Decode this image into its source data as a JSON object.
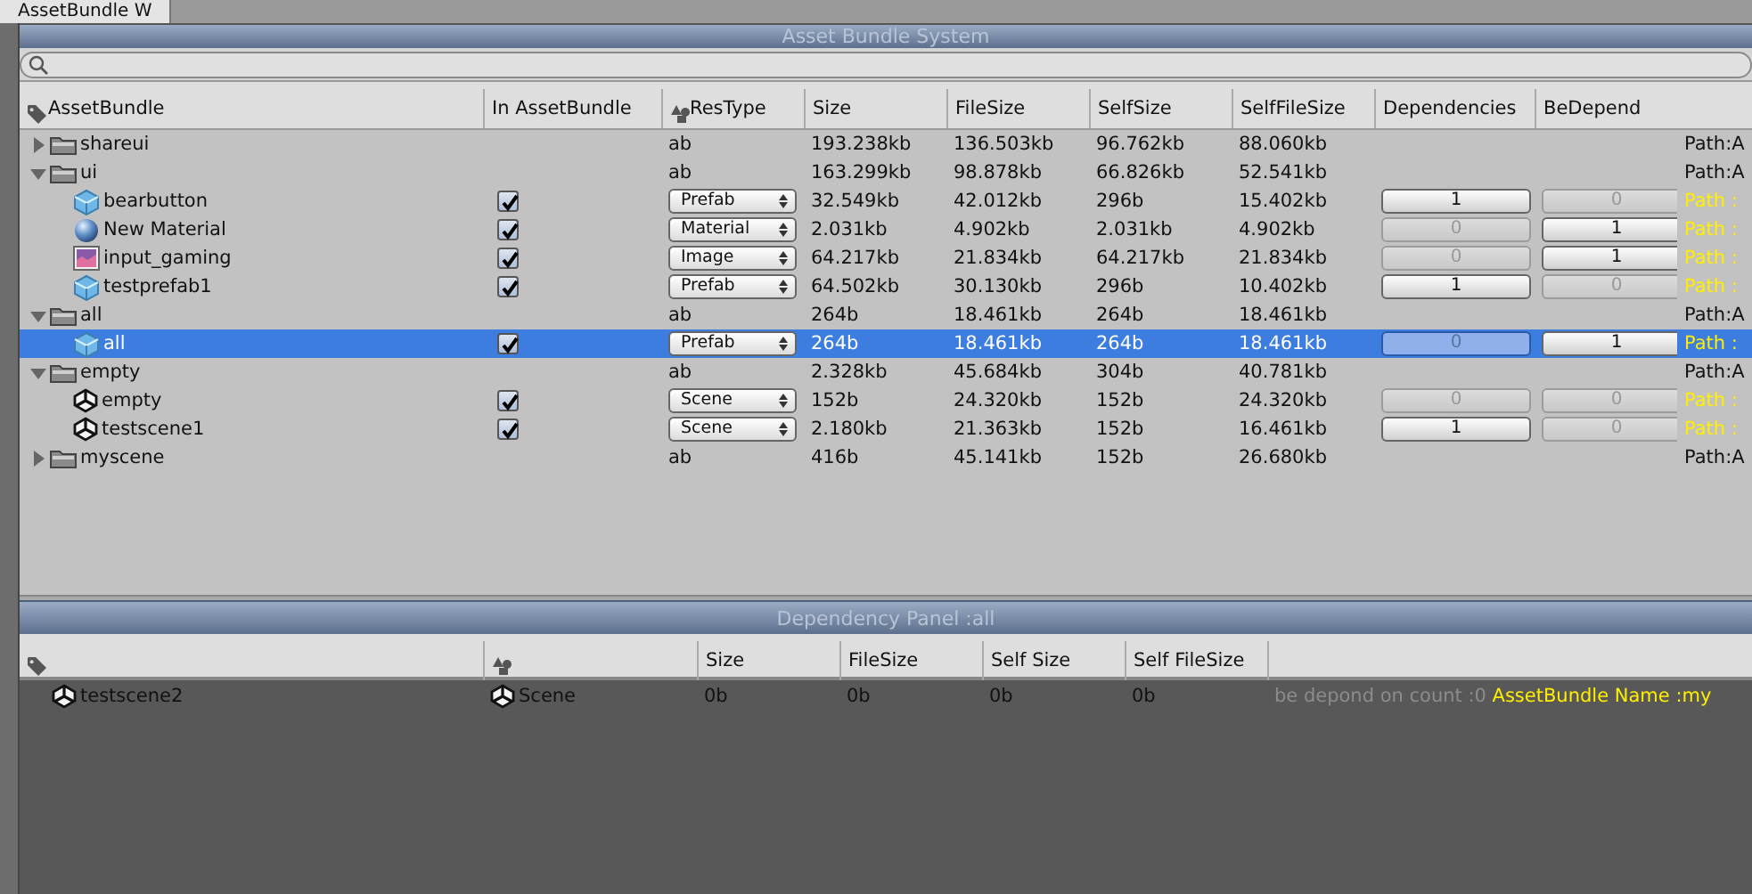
{
  "tab": {
    "title": "AssetBundle W"
  },
  "title": "Asset Bundle System",
  "columns": [
    "AssetBundle",
    "In AssetBundle",
    "ResType",
    "Size",
    "FileSize",
    "SelfSize",
    "SelfFileSize",
    "Dependencies",
    "BeDepend"
  ],
  "bundles": [
    {
      "name": "shareui",
      "expanded": false,
      "selected": false,
      "res_type": "ab",
      "size": "193.238kb",
      "file_size": "136.503kb",
      "self_size": "96.762kb",
      "self_file_size": "88.060kb",
      "path": "Path:A"
    },
    {
      "name": "ui",
      "expanded": true,
      "selected": false,
      "res_type": "ab",
      "size": "163.299kb",
      "file_size": "98.878kb",
      "self_size": "66.826kb",
      "self_file_size": "52.541kb",
      "path": "Path:A",
      "children": [
        {
          "name": "bearbutton",
          "kind": "prefab",
          "in_bundle": true,
          "selected": false,
          "res_type": "Prefab",
          "size": "32.549kb",
          "file_size": "42.012kb",
          "self_size": "296b",
          "self_file_size": "15.402kb",
          "dependencies": {
            "label": "1",
            "disabled": false
          },
          "be_depend": {
            "label": "0",
            "disabled": true
          },
          "path": "Path :"
        },
        {
          "name": "New Material",
          "kind": "material",
          "in_bundle": true,
          "selected": false,
          "res_type": "Material",
          "size": "2.031kb",
          "file_size": "4.902kb",
          "self_size": "2.031kb",
          "self_file_size": "4.902kb",
          "dependencies": {
            "label": "0",
            "disabled": true
          },
          "be_depend": {
            "label": "1",
            "disabled": false
          },
          "path": "Path :"
        },
        {
          "name": "input_gaming",
          "kind": "image",
          "in_bundle": true,
          "selected": false,
          "res_type": "Image",
          "size": "64.217kb",
          "file_size": "21.834kb",
          "self_size": "64.217kb",
          "self_file_size": "21.834kb",
          "dependencies": {
            "label": "0",
            "disabled": true
          },
          "be_depend": {
            "label": "1",
            "disabled": false
          },
          "path": "Path :"
        },
        {
          "name": "testprefab1",
          "kind": "prefab",
          "in_bundle": true,
          "selected": false,
          "res_type": "Prefab",
          "size": "64.502kb",
          "file_size": "30.130kb",
          "self_size": "296b",
          "self_file_size": "10.402kb",
          "dependencies": {
            "label": "1",
            "disabled": false
          },
          "be_depend": {
            "label": "0",
            "disabled": true
          },
          "path": "Path :"
        }
      ]
    },
    {
      "name": "all",
      "expanded": true,
      "selected": false,
      "res_type": "ab",
      "size": "264b",
      "file_size": "18.461kb",
      "self_size": "264b",
      "self_file_size": "18.461kb",
      "path": "Path:A",
      "children": [
        {
          "name": "all",
          "kind": "prefab",
          "in_bundle": true,
          "selected": true,
          "res_type": "Prefab",
          "size": "264b",
          "file_size": "18.461kb",
          "self_size": "264b",
          "self_file_size": "18.461kb",
          "dependencies": {
            "label": "0",
            "disabled": true
          },
          "be_depend": {
            "label": "1",
            "disabled": false
          },
          "path": "Path :"
        }
      ]
    },
    {
      "name": "empty",
      "expanded": true,
      "selected": false,
      "res_type": "ab",
      "size": "2.328kb",
      "file_size": "45.684kb",
      "self_size": "304b",
      "self_file_size": "40.781kb",
      "path": "Path:A",
      "children": [
        {
          "name": "empty",
          "kind": "scene",
          "in_bundle": true,
          "selected": false,
          "res_type": "Scene",
          "size": "152b",
          "file_size": "24.320kb",
          "self_size": "152b",
          "self_file_size": "24.320kb",
          "dependencies": {
            "label": "0",
            "disabled": true
          },
          "be_depend": {
            "label": "0",
            "disabled": true
          },
          "path": "Path :"
        },
        {
          "name": "testscene1",
          "kind": "scene",
          "in_bundle": true,
          "selected": false,
          "res_type": "Scene",
          "size": "2.180kb",
          "file_size": "21.363kb",
          "self_size": "152b",
          "self_file_size": "16.461kb",
          "dependencies": {
            "label": "1",
            "disabled": false
          },
          "be_depend": {
            "label": "0",
            "disabled": true
          },
          "path": "Path :"
        }
      ]
    },
    {
      "name": "myscene",
      "expanded": false,
      "selected": false,
      "res_type": "ab",
      "size": "416b",
      "file_size": "45.141kb",
      "self_size": "152b",
      "self_file_size": "26.680kb",
      "path": "Path:A"
    }
  ],
  "dependency_panel": {
    "title": "Dependency Panel :all",
    "columns": [
      "Size",
      "FileSize",
      "Self Size",
      "Self FileSize"
    ],
    "rows": [
      {
        "name": "testscene2",
        "kind": "scene",
        "res_type": "Scene",
        "size": "0b",
        "file_size": "0b",
        "self_size": "0b",
        "self_file_size": "0b",
        "info": "be depond on count :0",
        "bundle_name": "AssetBundle Name :my"
      }
    ]
  }
}
